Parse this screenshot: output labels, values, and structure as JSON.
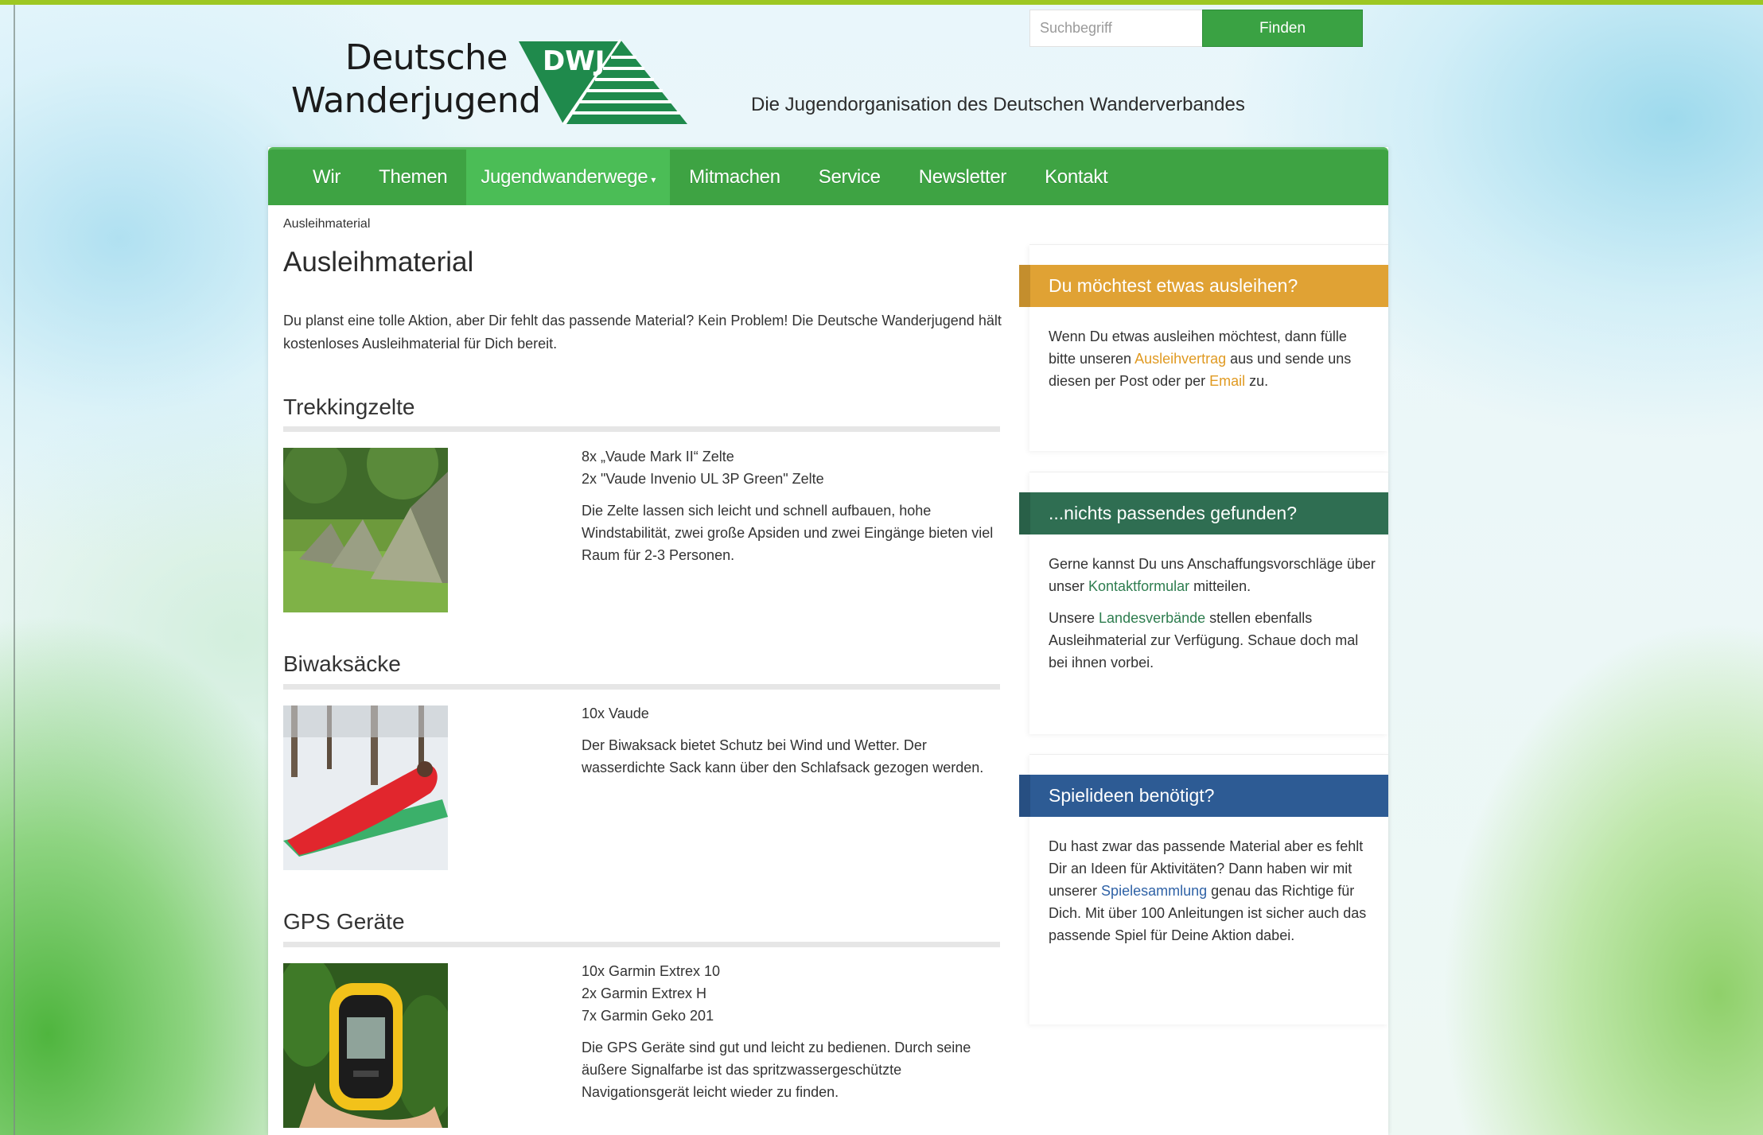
{
  "header": {
    "logo_line1": "Deutsche",
    "logo_line2": "Wanderjugend",
    "logo_badge": "DWJ",
    "tagline": "Die Jugendorganisation des Deutschen Wanderverbandes",
    "search_placeholder": "Suchbegriff",
    "search_button": "Finden"
  },
  "nav": {
    "items": [
      "Wir",
      "Themen",
      "Jugendwanderwege",
      "Mitmachen",
      "Service",
      "Newsletter",
      "Kontakt"
    ],
    "caret": "▾"
  },
  "breadcrumb": "Ausleihmaterial",
  "page_title": "Ausleihmaterial",
  "intro": "Du planst eine tolle Aktion, aber Dir fehlt das passende Material? Kein Problem! Die Deutsche Wanderjugend hält kostenloses Ausleihmaterial für Dich bereit.",
  "sections": [
    {
      "title": "Trekkingzelte",
      "lines": [
        "8x „Vaude Mark II“ Zelte",
        "2x \"Vaude Invenio UL 3P Green\" Zelte"
      ],
      "description": "Die Zelte lassen sich leicht und schnell aufbauen, hohe Windstabilität, zwei große Apsiden und zwei Eingänge bieten viel Raum für 2-3 Personen."
    },
    {
      "title": "Biwaksäcke",
      "lines": [
        "10x Vaude"
      ],
      "description": "Der Biwaksack bietet Schutz bei Wind und Wetter. Der wasserdichte Sack kann über den Schlafsack gezogen werden."
    },
    {
      "title": "GPS Geräte",
      "lines": [
        "10x Garmin Extrex 10",
        "2x Garmin Extrex H",
        "7x Garmin Geko 201"
      ],
      "description": "Die GPS Geräte sind gut und leicht zu bedienen. Durch seine äußere Signalfarbe ist das spritzwassergeschützte Navigationsgerät leicht wieder zu finden."
    }
  ],
  "sidebar": {
    "box1": {
      "title": "Du möchtest etwas ausleihen?",
      "color": "#e0a234",
      "p1_a": "Wenn Du etwas ausleihen möchtest, dann fülle bitte unseren ",
      "p1_link": "Ausleihvertrag",
      "p1_b": " aus und sende uns diesen per Post oder per ",
      "p1_link2": "Email",
      "p1_c": " zu."
    },
    "box2": {
      "title": "...nichts passendes gefunden?",
      "color": "#2f6e52",
      "p1_a": "Gerne kannst Du uns Anschaffungsvorschläge über unser ",
      "p1_link": "Kontaktformular",
      "p1_b": " mitteilen.",
      "p2_a": "Unsere ",
      "p2_link": "Landesverbände",
      "p2_b": " stellen ebenfalls Ausleihmaterial zur Verfügung. Schaue doch mal bei ihnen vorbei."
    },
    "box3": {
      "title": "Spielideen benötigt?",
      "color": "#2d5b94",
      "p1_a": "Du hast zwar das passende Material aber es fehlt Dir an Ideen für Aktivitäten? Dann haben wir mit unserer ",
      "p1_link": "Spielesammlung",
      "p1_b": " genau das Richtige für Dich. Mit über 100 Anleitungen ist sicher auch das passende Spiel für Deine Aktion dabei."
    }
  },
  "colors": {
    "nav_green": "#3ea343",
    "nav_active": "#4bbd56",
    "topbar": "#9dc722"
  }
}
